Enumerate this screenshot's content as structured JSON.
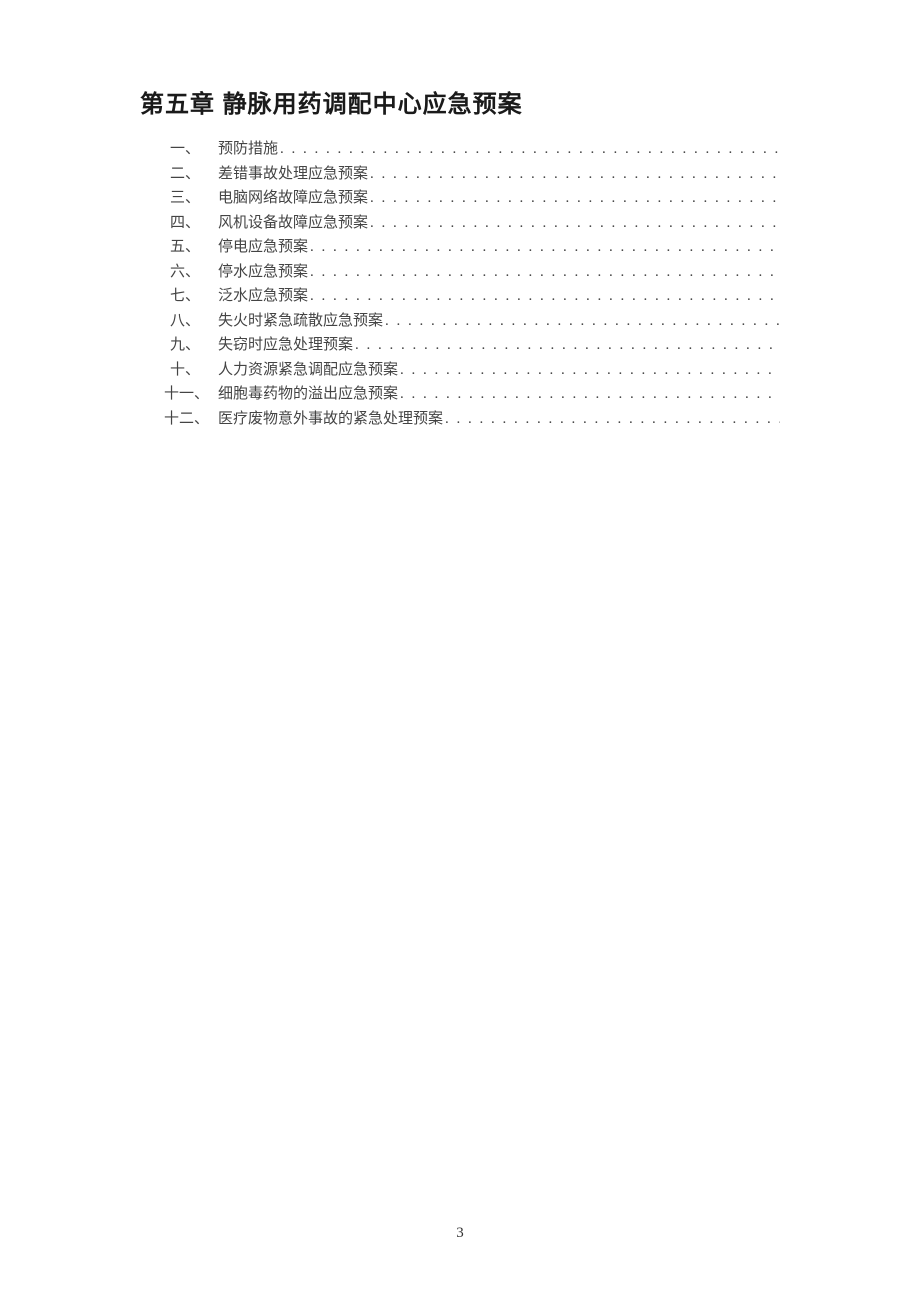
{
  "chapter_title": "第五章 静脉用药调配中心应急预案",
  "toc": [
    {
      "num": "一、",
      "label": "预防措施"
    },
    {
      "num": "二、",
      "label": "差错事故处理应急预案"
    },
    {
      "num": "三、",
      "label": "电脑网络故障应急预案"
    },
    {
      "num": "四、",
      "label": "风机设备故障应急预案"
    },
    {
      "num": "五、",
      "label": "停电应急预案"
    },
    {
      "num": "六、",
      "label": "停水应急预案"
    },
    {
      "num": "七、",
      "label": "泛水应急预案"
    },
    {
      "num": "八、",
      "label": "失火时紧急疏散应急预案"
    },
    {
      "num": "九、",
      "label": "失窃时应急处理预案"
    },
    {
      "num": "十、",
      "label": "人力资源紧急调配应急预案"
    },
    {
      "num": "十一、",
      "label": "细胞毒药物的溢出应急预案"
    },
    {
      "num": "十二、",
      "label": "医疗废物意外事故的紧急处理预案"
    }
  ],
  "page_number": "3",
  "dots": ". . . . . . . . . . . . . . . . . . . . . . . . . . . . . . . . . . . . . . . . . . . . . . . . . . . . . . . . . . . . . . . . . . . . . . . . . . . . . . . . . . . . . . . . . . . . . . . . . . . ."
}
